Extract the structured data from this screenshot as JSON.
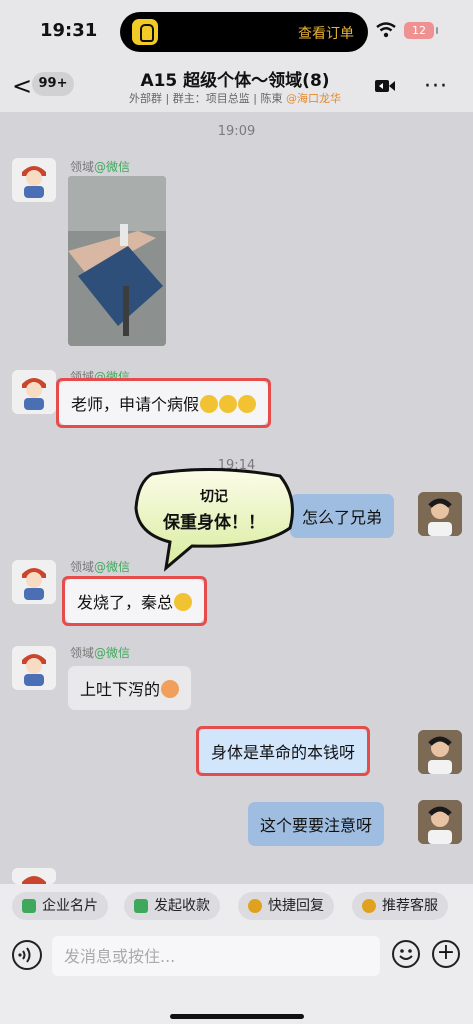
{
  "status_bar": {
    "time": "19:31",
    "island_text": "查看订单",
    "battery": "12"
  },
  "header": {
    "back_glyph": "<",
    "unread_count": "99+",
    "title": "A15 超级个体～领域(8)",
    "subtitle_group": "外部群",
    "subtitle_owner": "群主：项目总监",
    "subtitle_sep": "|",
    "subtitle_member": "陈東",
    "subtitle_member2": "@海口龙华",
    "more_glyph": "···"
  },
  "messages": {
    "time1": "19:09",
    "time2": "19:14",
    "sender1": "领域",
    "source": "@微信",
    "msg_sick_leave": "老师，申请个病假",
    "msg_whats_wrong": "怎么了兄弟",
    "msg_fever": "发烧了，秦总",
    "msg_vomit": "上吐下泻的",
    "msg_body_capital": "身体是革命的本钱呀",
    "msg_take_care": "这个要要注意呀"
  },
  "sticker": {
    "line1": "切记",
    "line2": "保重身体！！"
  },
  "quick_actions": [
    {
      "label": "企业名片",
      "color": "#3fa85b"
    },
    {
      "label": "发起收款",
      "color": "#3fa85b"
    },
    {
      "label": "快捷回复",
      "color": "#e0a21e"
    },
    {
      "label": "推荐客服",
      "color": "#e0a21e"
    }
  ],
  "input": {
    "placeholder": "发消息或按住...",
    "plus_glyph": "+"
  }
}
